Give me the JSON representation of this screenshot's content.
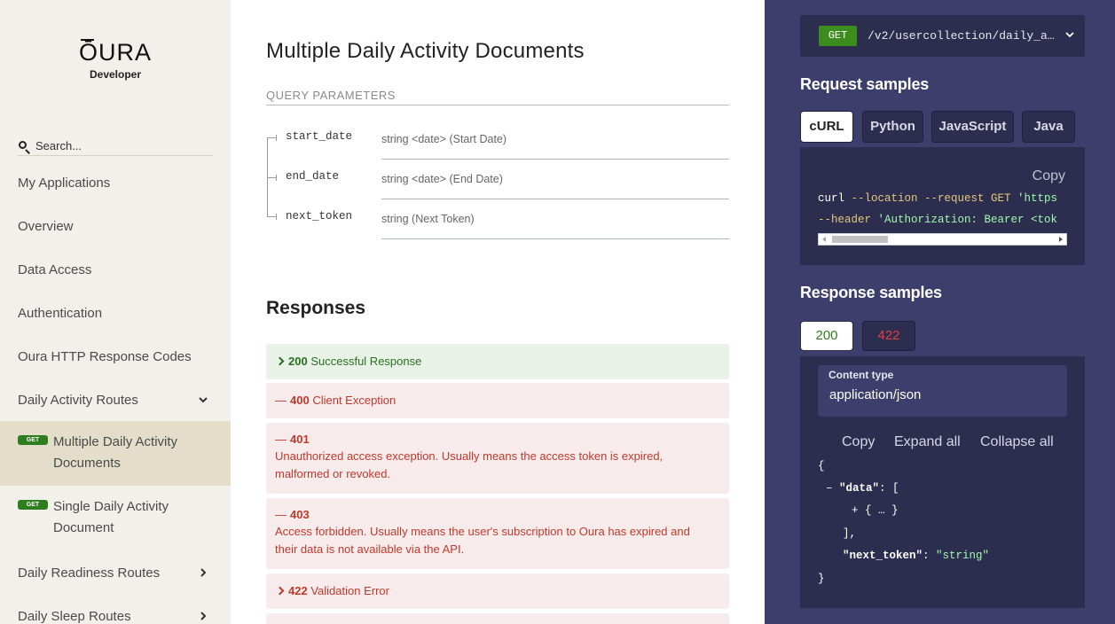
{
  "sidebar": {
    "logo": "ŌURA",
    "logo_sub": "Developer",
    "search_placeholder": "Search...",
    "items": [
      {
        "label": "My Applications"
      },
      {
        "label": "Overview"
      },
      {
        "label": "Data Access"
      },
      {
        "label": "Authentication"
      },
      {
        "label": "Oura HTTP Response Codes"
      },
      {
        "label": "Daily Activity Routes"
      },
      {
        "label": "Daily Readiness Routes"
      },
      {
        "label": "Daily Sleep Routes"
      }
    ],
    "sub_items": [
      {
        "badge": "GET",
        "label_line1": "Multiple Daily Activity",
        "label_line2": "Documents"
      },
      {
        "badge": "GET",
        "label_line1": "Single Daily Activity",
        "label_line2": "Document"
      }
    ]
  },
  "main": {
    "title": "Multiple Daily Activity Documents",
    "query_params_title": "QUERY PARAMETERS",
    "params": [
      {
        "name": "start_date",
        "type": "string <date> (Start Date)"
      },
      {
        "name": "end_date",
        "type": "string <date> (End Date)"
      },
      {
        "name": "next_token",
        "type": "string (Next Token)"
      }
    ],
    "responses_title": "Responses",
    "responses": [
      {
        "code": "200",
        "label": "Successful Response"
      },
      {
        "code": "400",
        "label": "Client Exception"
      },
      {
        "code": "401",
        "desc_line1": "Unauthorized access exception. Usually means the access token is expired,",
        "desc_line2": "malformed or revoked."
      },
      {
        "code": "403",
        "desc_line1": "Access forbidden. Usually means the user's subscription to Oura has expired and",
        "desc_line2": "their data is not available via the API."
      },
      {
        "code": "422",
        "label": "Validation Error"
      }
    ]
  },
  "right": {
    "method": "GET",
    "path": "/v2/usercollection/daily_a…",
    "request_samples_title": "Request samples",
    "lang_tabs": [
      "cURL",
      "Python",
      "JavaScript",
      "Java"
    ],
    "copy_label": "Copy",
    "code": {
      "l1_a": "curl ",
      "l1_b": "--location --request GET ",
      "l1_c": "'https",
      "l2_a": "--header ",
      "l2_b": "'Authorization: Bearer <tok"
    },
    "response_samples_title": "Response samples",
    "status_tabs": [
      "200",
      "422"
    ],
    "content_type_label": "Content type",
    "content_type_value": "application/json",
    "actions": [
      "Copy",
      "Expand all",
      "Collapse all"
    ],
    "json": {
      "open": "{",
      "minus": "–",
      "data_key": "\"data\"",
      "colon_bracket": ": [",
      "plus": "+",
      "collapsed": "{ … }",
      "close_arr": "],",
      "next_key": "\"next_token\"",
      "colon": ": ",
      "next_val": "\"string\"",
      "close": "}"
    }
  },
  "colors": {
    "sidebar_bg": "#f2f0ea",
    "active_bg": "#e4ddc9",
    "right_bg": "#3d3e6b",
    "panel_bg": "#2c2d4f",
    "get_green": "#3c8d1e",
    "success_green": "#2a6e22",
    "error_red": "#c0392b"
  }
}
